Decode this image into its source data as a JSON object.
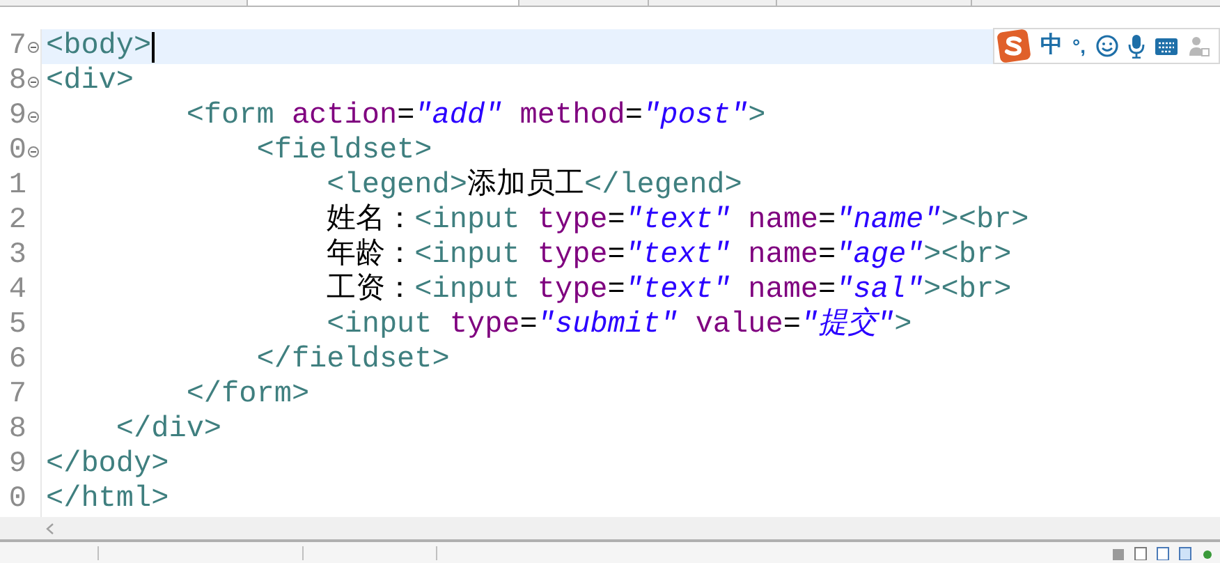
{
  "editor": {
    "lines": [
      {
        "number": "7",
        "fold": true,
        "selected": true,
        "tokens": [
          {
            "kind": "tag",
            "text": "<body>"
          }
        ]
      },
      {
        "number": "8",
        "fold": true,
        "selected": false,
        "tokens": [
          {
            "kind": "tag",
            "text": "<div>"
          }
        ]
      },
      {
        "number": "9",
        "fold": true,
        "selected": false,
        "tokens": [
          {
            "kind": "tag",
            "text": "\t\t<form"
          },
          {
            "kind": "attr",
            "text": " action"
          },
          {
            "kind": "plain",
            "text": "="
          },
          {
            "kind": "value",
            "text": "\"add\""
          },
          {
            "kind": "attr",
            "text": " method"
          },
          {
            "kind": "plain",
            "text": "="
          },
          {
            "kind": "value",
            "text": "\"post\""
          },
          {
            "kind": "tag",
            "text": ">"
          }
        ]
      },
      {
        "number": "0",
        "fold": true,
        "selected": false,
        "tokens": [
          {
            "kind": "tag",
            "text": "\t\t\t<fieldset>"
          }
        ]
      },
      {
        "number": "1",
        "fold": false,
        "selected": false,
        "tokens": [
          {
            "kind": "tag",
            "text": "\t\t\t\t<legend>"
          },
          {
            "kind": "plain",
            "text": "添加员工"
          },
          {
            "kind": "tag",
            "text": "</legend>"
          }
        ]
      },
      {
        "number": "2",
        "fold": false,
        "selected": false,
        "tokens": [
          {
            "kind": "plain",
            "text": "\t\t\t\t姓名："
          },
          {
            "kind": "tag",
            "text": "<input"
          },
          {
            "kind": "attr",
            "text": " type"
          },
          {
            "kind": "plain",
            "text": "="
          },
          {
            "kind": "value",
            "text": "\"text\""
          },
          {
            "kind": "attr",
            "text": " name"
          },
          {
            "kind": "plain",
            "text": "="
          },
          {
            "kind": "value",
            "text": "\"name\""
          },
          {
            "kind": "tag",
            "text": "><br>"
          }
        ]
      },
      {
        "number": "3",
        "fold": false,
        "selected": false,
        "tokens": [
          {
            "kind": "plain",
            "text": "\t\t\t\t年龄："
          },
          {
            "kind": "tag",
            "text": "<input"
          },
          {
            "kind": "attr",
            "text": " type"
          },
          {
            "kind": "plain",
            "text": "="
          },
          {
            "kind": "value",
            "text": "\"text\""
          },
          {
            "kind": "attr",
            "text": " name"
          },
          {
            "kind": "plain",
            "text": "="
          },
          {
            "kind": "value",
            "text": "\"age\""
          },
          {
            "kind": "tag",
            "text": "><br>"
          }
        ]
      },
      {
        "number": "4",
        "fold": false,
        "selected": false,
        "tokens": [
          {
            "kind": "plain",
            "text": "\t\t\t\t工资："
          },
          {
            "kind": "tag",
            "text": "<input"
          },
          {
            "kind": "attr",
            "text": " type"
          },
          {
            "kind": "plain",
            "text": "="
          },
          {
            "kind": "value",
            "text": "\"text\""
          },
          {
            "kind": "attr",
            "text": " name"
          },
          {
            "kind": "plain",
            "text": "="
          },
          {
            "kind": "value",
            "text": "\"sal\""
          },
          {
            "kind": "tag",
            "text": "><br>"
          }
        ]
      },
      {
        "number": "5",
        "fold": false,
        "selected": false,
        "tokens": [
          {
            "kind": "tag",
            "text": "\t\t\t\t<input"
          },
          {
            "kind": "attr",
            "text": " type"
          },
          {
            "kind": "plain",
            "text": "="
          },
          {
            "kind": "value",
            "text": "\"submit\""
          },
          {
            "kind": "attr",
            "text": " value"
          },
          {
            "kind": "plain",
            "text": "="
          },
          {
            "kind": "value",
            "text": "\"提交\""
          },
          {
            "kind": "tag",
            "text": ">"
          }
        ]
      },
      {
        "number": "6",
        "fold": false,
        "selected": false,
        "tokens": [
          {
            "kind": "tag",
            "text": "\t\t\t</fieldset>"
          }
        ]
      },
      {
        "number": "7",
        "fold": false,
        "selected": false,
        "tokens": [
          {
            "kind": "tag",
            "text": "\t\t</form>"
          }
        ]
      },
      {
        "number": "8",
        "fold": false,
        "selected": false,
        "tokens": [
          {
            "kind": "tag",
            "text": "\t</div>"
          }
        ]
      },
      {
        "number": "9",
        "fold": false,
        "selected": false,
        "tokens": [
          {
            "kind": "tag",
            "text": "</body>"
          }
        ]
      },
      {
        "number": "0",
        "fold": false,
        "selected": false,
        "tokens": [
          {
            "kind": "tag",
            "text": "</html>"
          }
        ]
      }
    ]
  },
  "ime_toolbar": {
    "mode": "中",
    "punctuation": "°,"
  }
}
